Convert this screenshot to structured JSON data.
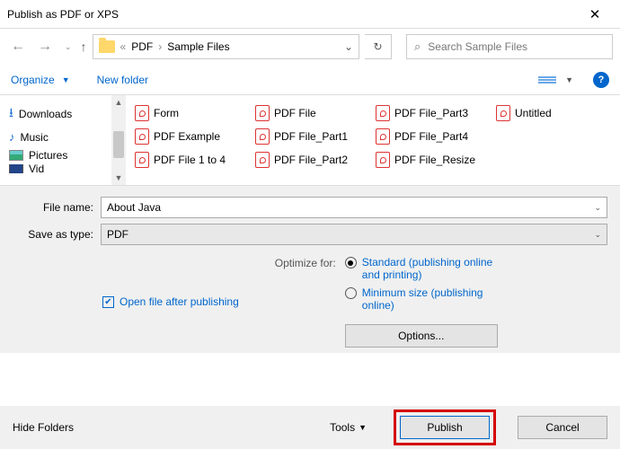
{
  "title": "Publish as PDF or XPS",
  "breadcrumbs": {
    "sep0": "«",
    "a": "PDF",
    "b": "Sample Files"
  },
  "search": {
    "placeholder": "Search Sample Files"
  },
  "cmd": {
    "organize": "Organize",
    "newfolder": "New folder"
  },
  "nav": {
    "items": [
      {
        "label": "Downloads"
      },
      {
        "label": "Music"
      },
      {
        "label": "Pictures"
      },
      {
        "label": "Vid"
      }
    ]
  },
  "files": [
    "Form",
    "PDF File",
    "PDF File_Part3",
    "Untitled",
    "PDF Example",
    "PDF File_Part1",
    "PDF File_Part4",
    "PDF File 1 to 4",
    "PDF File_Part2",
    "PDF File_Resize"
  ],
  "form": {
    "filename_label": "File name:",
    "filename_value": "About Java",
    "savetype_label": "Save as type:",
    "savetype_value": "PDF",
    "open_after": "Open file after publishing",
    "optimize_label": "Optimize for:",
    "radio1": "Standard (publishing online and printing)",
    "radio2": "Minimum size (publishing online)",
    "options_btn": "Options..."
  },
  "footer": {
    "hide": "Hide Folders",
    "tools": "Tools",
    "publish": "Publish",
    "cancel": "Cancel"
  }
}
